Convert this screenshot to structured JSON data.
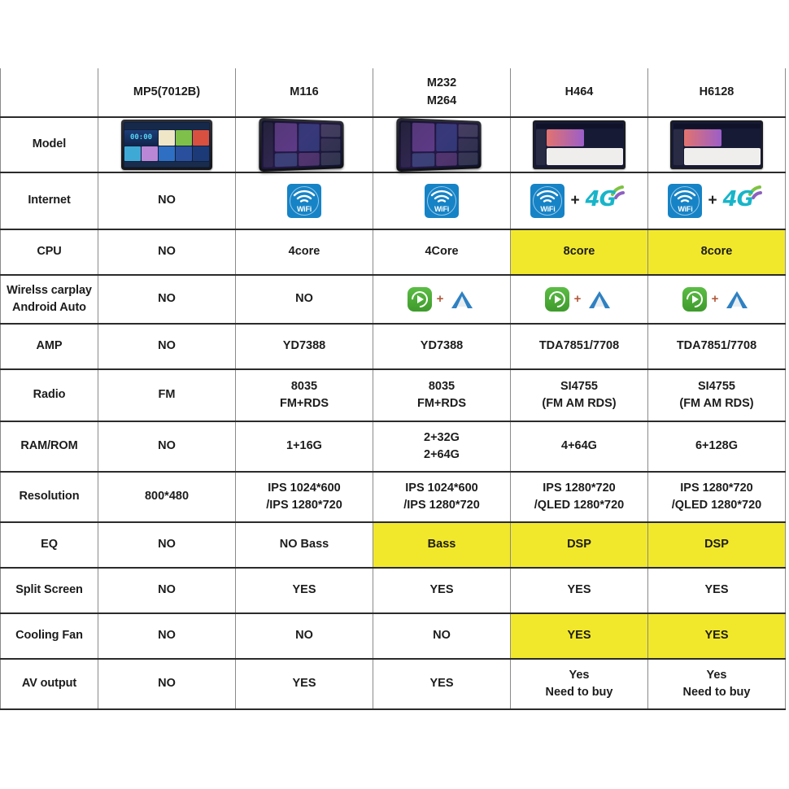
{
  "table": {
    "corner_label": "",
    "columns": [
      {
        "id": "mp5",
        "label": "MP5(7012B)",
        "label_line2": ""
      },
      {
        "id": "m116",
        "label": "M116",
        "label_line2": ""
      },
      {
        "id": "m232",
        "label": "M232",
        "label_line2": "M264"
      },
      {
        "id": "h464",
        "label": "H464",
        "label_line2": ""
      },
      {
        "id": "h6128",
        "label": "H6128",
        "label_line2": ""
      }
    ],
    "rows": [
      {
        "label": "Model",
        "cells": [
          {
            "type": "image",
            "icon": "mp5-head-unit-image",
            "text": ""
          },
          {
            "type": "image",
            "icon": "m116-head-unit-image",
            "text": ""
          },
          {
            "type": "image",
            "icon": "m232-head-unit-image",
            "text": ""
          },
          {
            "type": "image",
            "icon": "h464-head-unit-image",
            "text": ""
          },
          {
            "type": "image",
            "icon": "h6128-head-unit-image",
            "text": ""
          }
        ]
      },
      {
        "label": "Internet",
        "cells": [
          {
            "type": "text",
            "text": "NO"
          },
          {
            "type": "wifi",
            "text": "WiFi"
          },
          {
            "type": "wifi",
            "text": "WiFi"
          },
          {
            "type": "wifi4g",
            "text": "WiFi",
            "plus": "+",
            "text2": "4G"
          },
          {
            "type": "wifi4g",
            "text": "WiFi",
            "plus": "+",
            "text2": "4G"
          }
        ]
      },
      {
        "label": "CPU",
        "cells": [
          {
            "type": "text",
            "text": "NO"
          },
          {
            "type": "text",
            "text": "4core"
          },
          {
            "type": "text",
            "text": "4Core"
          },
          {
            "type": "text",
            "text": "8core",
            "highlight": true
          },
          {
            "type": "text",
            "text": "8core",
            "highlight": true
          }
        ]
      },
      {
        "label": "Wirelss carplay",
        "label_line2": "Android Auto",
        "cells": [
          {
            "type": "text",
            "text": "NO"
          },
          {
            "type": "text",
            "text": "NO"
          },
          {
            "type": "carplay",
            "plus": "+"
          },
          {
            "type": "carplay",
            "plus": "+"
          },
          {
            "type": "carplay",
            "plus": "+"
          }
        ]
      },
      {
        "label": "AMP",
        "cells": [
          {
            "type": "text",
            "text": "NO"
          },
          {
            "type": "text",
            "text": "YD7388"
          },
          {
            "type": "text",
            "text": "YD7388"
          },
          {
            "type": "text",
            "text": "TDA7851/7708"
          },
          {
            "type": "text",
            "text": "TDA7851/7708"
          }
        ]
      },
      {
        "label": "Radio",
        "cells": [
          {
            "type": "text",
            "text": "FM"
          },
          {
            "type": "text",
            "text": "8035",
            "text2": "FM+RDS"
          },
          {
            "type": "text",
            "text": "8035",
            "text2": "FM+RDS"
          },
          {
            "type": "text",
            "text": "SI4755",
            "text2": "(FM AM RDS)"
          },
          {
            "type": "text",
            "text": "SI4755",
            "text2": "(FM AM RDS)"
          }
        ]
      },
      {
        "label": "RAM/ROM",
        "cells": [
          {
            "type": "text",
            "text": "NO"
          },
          {
            "type": "text",
            "text": "1+16G"
          },
          {
            "type": "text",
            "text": "2+32G",
            "text2": "2+64G"
          },
          {
            "type": "text",
            "text": "4+64G"
          },
          {
            "type": "text",
            "text": "6+128G"
          }
        ]
      },
      {
        "label": "Resolution",
        "cells": [
          {
            "type": "text",
            "text": "800*480"
          },
          {
            "type": "text",
            "text": "IPS 1024*600",
            "text2": "/IPS 1280*720"
          },
          {
            "type": "text",
            "text": "IPS 1024*600",
            "text2": "/IPS 1280*720"
          },
          {
            "type": "text",
            "text": "IPS 1280*720",
            "text2": "/QLED 1280*720"
          },
          {
            "type": "text",
            "text": "IPS 1280*720",
            "text2": "/QLED 1280*720"
          }
        ]
      },
      {
        "label": "EQ",
        "cells": [
          {
            "type": "text",
            "text": "NO"
          },
          {
            "type": "text",
            "text": "NO Bass"
          },
          {
            "type": "text",
            "text": "Bass",
            "highlight": true
          },
          {
            "type": "text",
            "text": "DSP",
            "highlight": true
          },
          {
            "type": "text",
            "text": "DSP",
            "highlight": true
          }
        ]
      },
      {
        "label": "Split Screen",
        "cells": [
          {
            "type": "text",
            "text": "NO"
          },
          {
            "type": "text",
            "text": "YES"
          },
          {
            "type": "text",
            "text": "YES"
          },
          {
            "type": "text",
            "text": "YES"
          },
          {
            "type": "text",
            "text": "YES"
          }
        ]
      },
      {
        "label": "Cooling Fan",
        "cells": [
          {
            "type": "text",
            "text": "NO"
          },
          {
            "type": "text",
            "text": "NO"
          },
          {
            "type": "text",
            "text": "NO"
          },
          {
            "type": "text",
            "text": "YES",
            "highlight": true
          },
          {
            "type": "text",
            "text": "YES",
            "highlight": true
          }
        ]
      },
      {
        "label": "AV output",
        "cells": [
          {
            "type": "text",
            "text": "NO"
          },
          {
            "type": "text",
            "text": "YES"
          },
          {
            "type": "text",
            "text": "YES"
          },
          {
            "type": "text",
            "text": "Yes",
            "text2": "Need to buy"
          },
          {
            "type": "text",
            "text": "Yes",
            "text2": "Need to buy"
          }
        ]
      }
    ]
  },
  "colors": {
    "highlight": "#f2e82b",
    "wifi_blue": "#1683c6",
    "fourg_teal": "#18b5c9",
    "carplay_green": "#4faa34",
    "androidauto_blue": "#2f81c2",
    "border_dark": "#2b2b2b"
  }
}
